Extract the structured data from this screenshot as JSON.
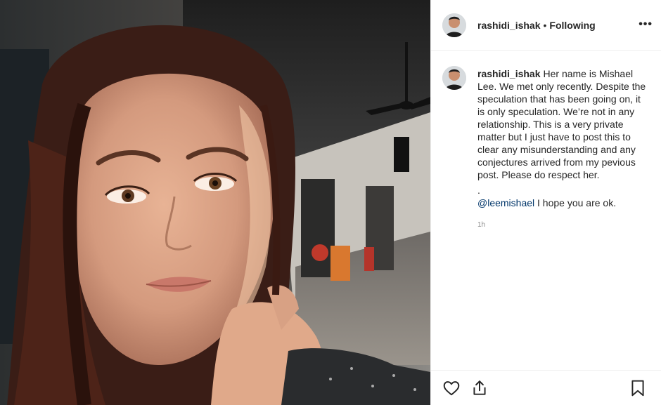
{
  "post": {
    "author": "rashidi_ishak",
    "separator": "•",
    "follow_status": "Following",
    "more_label": "•••"
  },
  "caption": {
    "username": "rashidi_ishak",
    "text": "Her name is Mishael Lee. We met only recently. Despite the speculation that has been going on, it is only speculation. We’re not in any relationship. This is a very private matter but I just have to post this to clear any misunderstanding and any conjectures arrived from my pevious post. Please do respect her.",
    "dot_line": ".",
    "mention": "@leemishael",
    "mention_rest": " I hope you are ok.",
    "time_ago": "1h"
  },
  "icons": {
    "like": "heart-icon",
    "share": "share-icon",
    "save": "bookmark-icon",
    "more": "more-options-icon"
  },
  "colors": {
    "text": "#262626",
    "secondary": "#8e8e8e",
    "mention": "#003569",
    "border": "#efefef"
  }
}
